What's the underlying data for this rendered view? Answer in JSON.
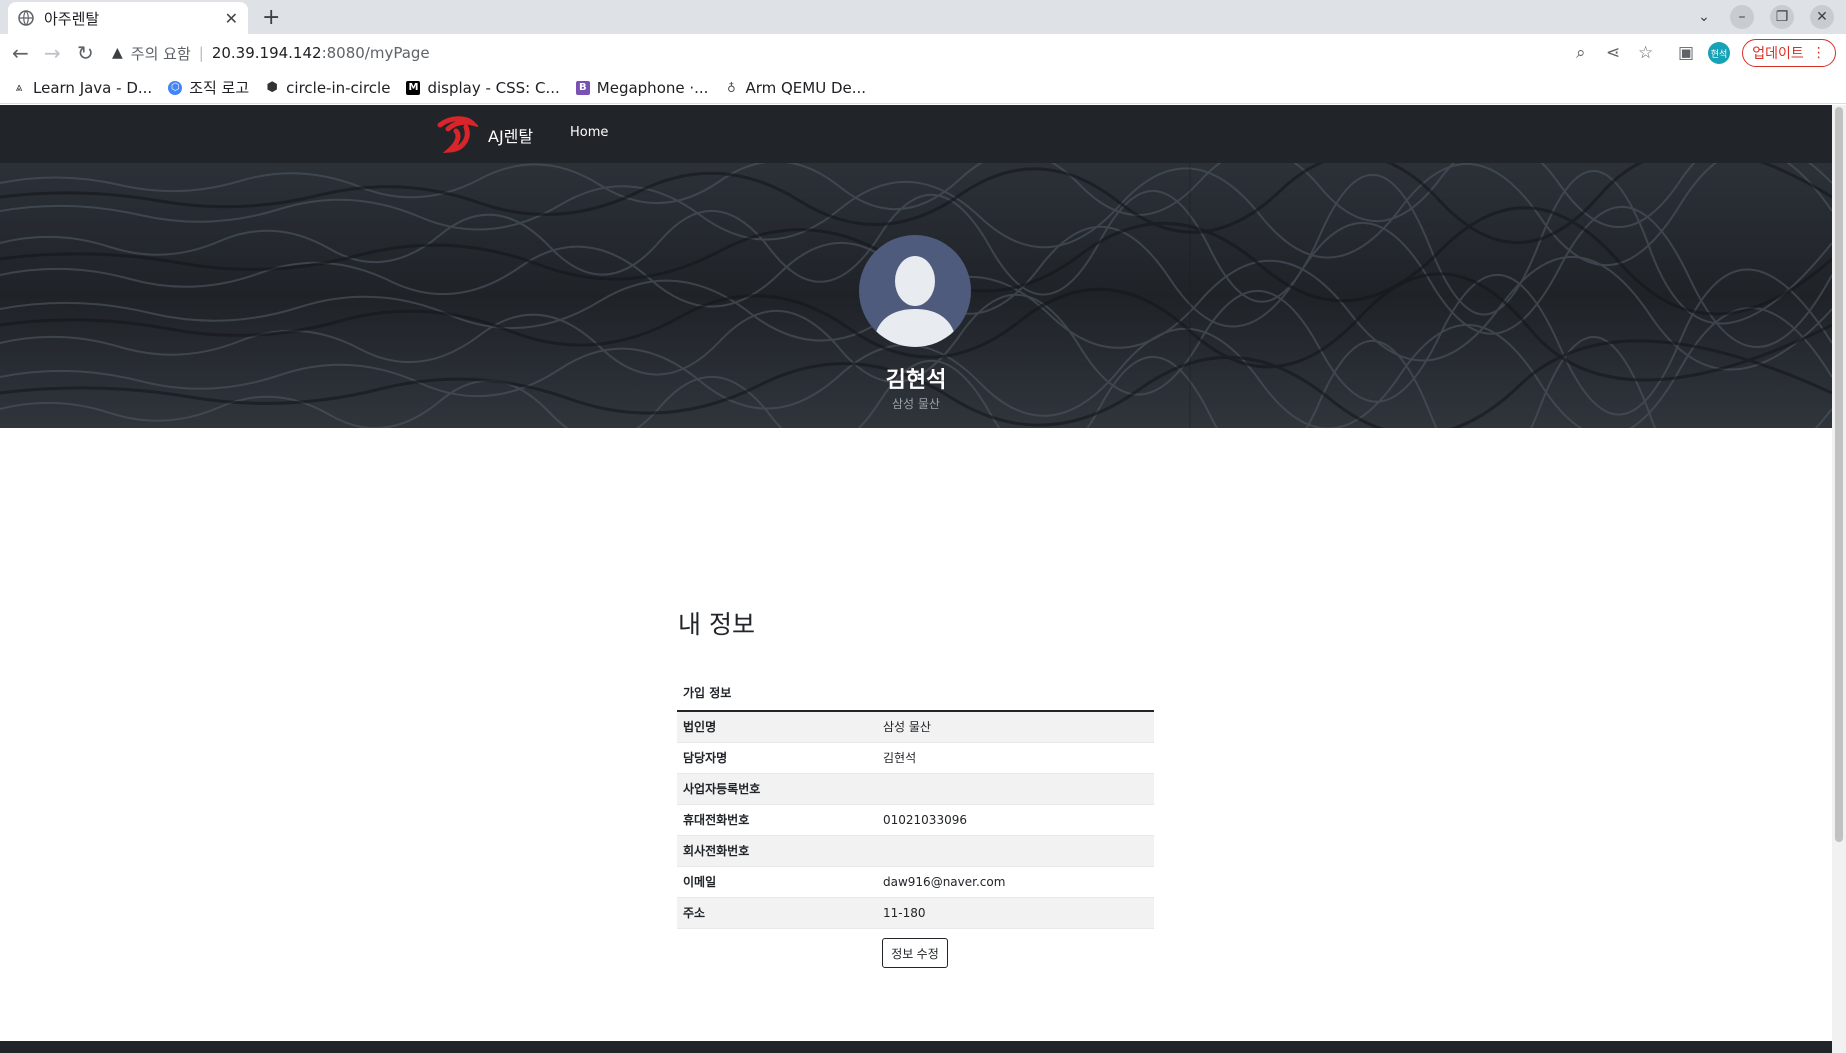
{
  "browser": {
    "tab_title": "아주렌탈",
    "address_warning": "주의 요함",
    "address_host": "20.39.194.142",
    "address_path": ":8080/myPage",
    "profile_chip": "현석",
    "update_label": "업데이트",
    "bookmarks": [
      {
        "label": "Learn Java - D...",
        "icon_color": "#333333"
      },
      {
        "label": "조직 로고",
        "icon_color": "#4285f4"
      },
      {
        "label": "circle-in-circle",
        "icon_color": "#333333"
      },
      {
        "label": "display - CSS: C...",
        "icon_color": "#000000"
      },
      {
        "label": "Megaphone ·...",
        "icon_color": "#7952b3"
      },
      {
        "label": "Arm QEMU De...",
        "icon_color": "#555555"
      }
    ]
  },
  "site": {
    "brand_name": "AJ렌탈",
    "nav_home": "Home",
    "brand_color": "#d9252a",
    "nav_bg": "#212529"
  },
  "profile": {
    "name": "김현석",
    "company": "삼성 물산"
  },
  "info": {
    "title": "내 정보",
    "table_header": "가입 정보",
    "rows": [
      {
        "label": "법인명",
        "value": "삼성 물산"
      },
      {
        "label": "담당자명",
        "value": "김현석"
      },
      {
        "label": "사업자등록번호",
        "value": ""
      },
      {
        "label": "휴대전화번호",
        "value": "01021033096"
      },
      {
        "label": "회사전화번호",
        "value": ""
      },
      {
        "label": "이메일",
        "value": "daw916@naver.com"
      },
      {
        "label": "주소",
        "value": "11-180"
      }
    ],
    "edit_button": "정보 수정"
  }
}
